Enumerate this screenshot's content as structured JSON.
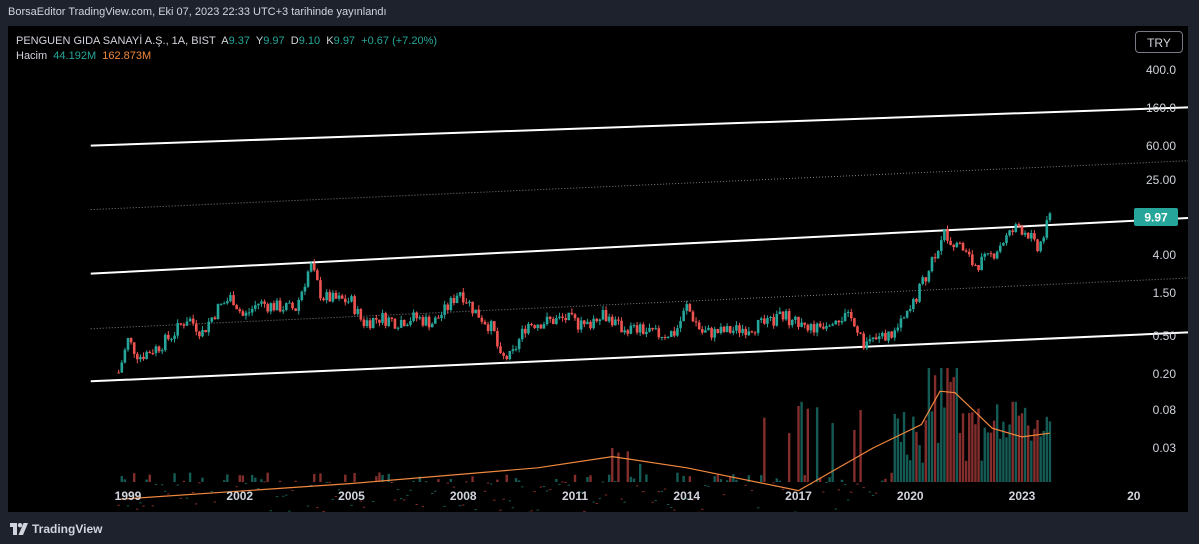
{
  "header": {
    "published_line": "BorsaEditor TradingView.com, Eki 07, 2023 22:33 UTC+3 tarihinde yayınlandı"
  },
  "legend": {
    "symbol": "PENGUEN GIDA SANAYİ A.Ş., 1A, BIST",
    "open_label": "A",
    "open_value": "9.37",
    "high_label": "Y",
    "high_value": "9.97",
    "low_label": "D",
    "low_value": "9.10",
    "close_label": "K",
    "close_value": "9.97",
    "change": "+0.67 (+7.20%)",
    "volume_label": "Hacim",
    "volume_value": "44.192M",
    "volume_ma_value": "162.873M"
  },
  "currency": "TRY",
  "footer": {
    "brand": "TradingView"
  },
  "colors": {
    "up": "#26a69a",
    "down": "#ef5350",
    "volume_ma": "#f0883e",
    "background": "#000000",
    "price_tag": "#26a69a"
  },
  "chart_data": {
    "type": "candlestick",
    "scale": "log",
    "interval": "1 month",
    "grid": false,
    "y_ticks": [
      "400.0",
      "160.0",
      "60.00",
      "25.00",
      "4.00",
      "1.50",
      "0.50",
      "0.20",
      "0.08",
      "0.03"
    ],
    "x_ticks": [
      "1999",
      "2002",
      "2005",
      "2008",
      "2011",
      "2014",
      "2017",
      "2020",
      "2023",
      "20"
    ],
    "last_price": "9.97",
    "price_path": [
      [
        1998.75,
        0.2
      ],
      [
        1999.0,
        0.45
      ],
      [
        1999.3,
        0.3
      ],
      [
        1999.8,
        0.38
      ],
      [
        2000.2,
        0.52
      ],
      [
        2000.6,
        0.8
      ],
      [
        2001.0,
        0.55
      ],
      [
        2001.4,
        1.0
      ],
      [
        2001.8,
        1.35
      ],
      [
        2002.1,
        0.8
      ],
      [
        2002.5,
        1.15
      ],
      [
        2003.0,
        1.05
      ],
      [
        2003.5,
        1.0
      ],
      [
        2003.9,
        3.0
      ],
      [
        2004.2,
        1.35
      ],
      [
        2004.6,
        1.25
      ],
      [
        2005.0,
        1.2
      ],
      [
        2005.3,
        0.7
      ],
      [
        2005.8,
        0.8
      ],
      [
        2006.2,
        0.72
      ],
      [
        2006.7,
        0.8
      ],
      [
        2007.2,
        0.7
      ],
      [
        2007.6,
        1.05
      ],
      [
        2007.9,
        1.6
      ],
      [
        2008.3,
        0.95
      ],
      [
        2008.8,
        0.6
      ],
      [
        2009.0,
        0.28
      ],
      [
        2009.3,
        0.3
      ],
      [
        2009.7,
        0.68
      ],
      [
        2010.2,
        0.72
      ],
      [
        2010.8,
        0.78
      ],
      [
        2011.3,
        0.62
      ],
      [
        2011.7,
        0.95
      ],
      [
        2012.2,
        0.62
      ],
      [
        2012.8,
        0.58
      ],
      [
        2013.2,
        0.52
      ],
      [
        2013.7,
        0.55
      ],
      [
        2014.0,
        1.05
      ],
      [
        2014.4,
        0.55
      ],
      [
        2014.8,
        0.55
      ],
      [
        2015.3,
        0.58
      ],
      [
        2015.8,
        0.65
      ],
      [
        2016.2,
        0.68
      ],
      [
        2016.6,
        0.85
      ],
      [
        2017.0,
        0.7
      ],
      [
        2017.5,
        0.62
      ],
      [
        2018.0,
        0.85
      ],
      [
        2018.5,
        0.75
      ],
      [
        2018.8,
        0.4
      ],
      [
        2019.2,
        0.48
      ],
      [
        2019.6,
        0.55
      ],
      [
        2020.0,
        0.95
      ],
      [
        2020.3,
        1.8
      ],
      [
        2020.7,
        4.5
      ],
      [
        2020.9,
        7.0
      ],
      [
        2021.3,
        5.0
      ],
      [
        2021.7,
        3.0
      ],
      [
        2022.1,
        3.5
      ],
      [
        2022.5,
        5.5
      ],
      [
        2022.9,
        8.0
      ],
      [
        2023.2,
        6.5
      ],
      [
        2023.4,
        4.2
      ],
      [
        2023.6,
        6.5
      ],
      [
        2023.75,
        9.97
      ]
    ],
    "volume_ma_path": [
      [
        1998.8,
        0.008
      ],
      [
        2005.0,
        0.012
      ],
      [
        2010.0,
        0.018
      ],
      [
        2012.0,
        0.024
      ],
      [
        2014.0,
        0.018
      ],
      [
        2017.0,
        0.01
      ],
      [
        2019.0,
        0.03
      ],
      [
        2020.3,
        0.055
      ],
      [
        2020.8,
        0.13
      ],
      [
        2021.2,
        0.125
      ],
      [
        2022.2,
        0.05
      ],
      [
        2023.0,
        0.04
      ],
      [
        2023.75,
        0.044
      ]
    ],
    "channel_lines": [
      {
        "style": "solid",
        "x": [
          1998,
          2028
        ],
        "y": [
          60.0,
          160.0
        ]
      },
      {
        "style": "dashed",
        "x": [
          1998,
          2028
        ],
        "y": [
          12.0,
          42.0
        ]
      },
      {
        "style": "solid",
        "x": [
          1998,
          2028
        ],
        "y": [
          2.4,
          9.97
        ]
      },
      {
        "style": "dashed",
        "x": [
          1998,
          2028
        ],
        "y": [
          0.6,
          2.2
        ]
      },
      {
        "style": "solid",
        "x": [
          1998,
          2028
        ],
        "y": [
          0.16,
          0.56
        ]
      }
    ]
  }
}
